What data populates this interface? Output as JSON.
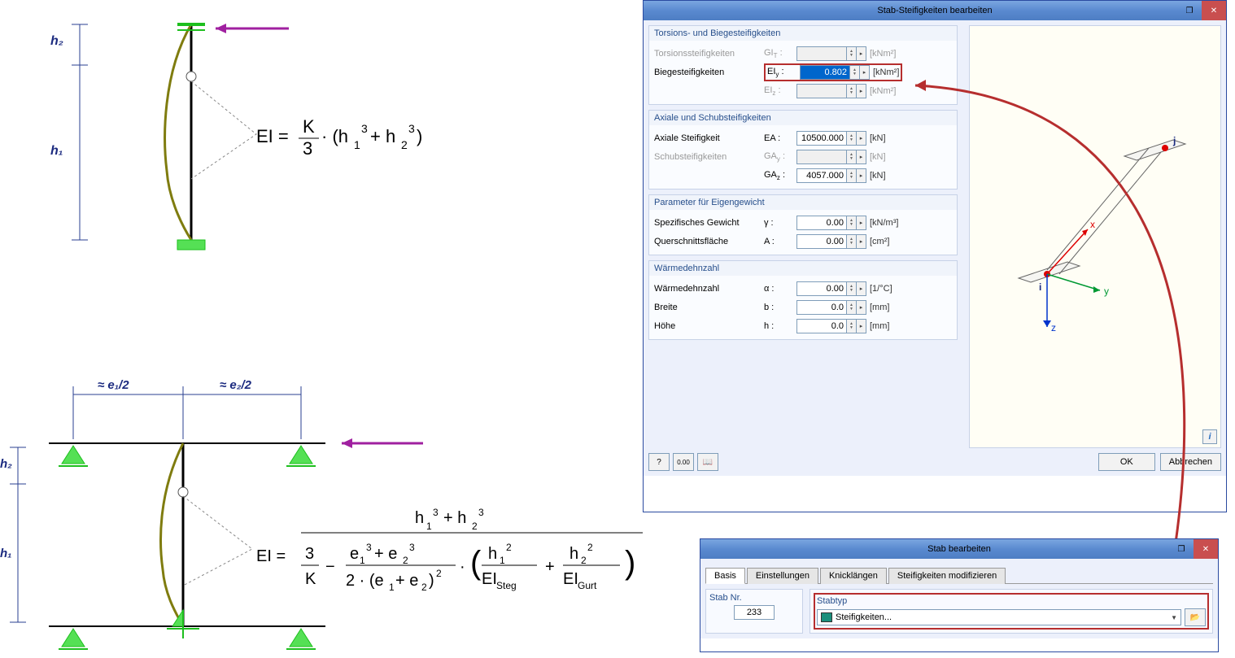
{
  "dialog1": {
    "title": "Stab-Steifigkeiten bearbeiten",
    "group1_title": "Torsions- und Biegesteifigkeiten",
    "row_torsion_label": "Torsionssteifigkeiten",
    "sym_GIT": "GIT :",
    "unit_kNm2": "[kNm²]",
    "row_biege_label": "Biegesteifigkeiten",
    "sym_EIy": "EIy :",
    "val_EIy": "0.802",
    "sym_EIz": "EIz :",
    "group2_title": "Axiale und Schubsteifigkeiten",
    "row_axial_label": "Axiale Steifigkeit",
    "sym_EA": "EA :",
    "val_EA": "10500.000",
    "unit_kN": "[kN]",
    "row_schub_label": "Schubsteifigkeiten",
    "sym_GAy": "GAy :",
    "sym_GAz": "GAz :",
    "val_GAz": "4057.000",
    "group3_title": "Parameter für Eigengewicht",
    "row_spez_label": "Spezifisches Gewicht",
    "sym_gamma": "γ :",
    "val_gamma": "0.00",
    "unit_kNm3": "[kN/m³]",
    "row_quer_label": "Querschnittsfläche",
    "sym_A": "A :",
    "val_A": "0.00",
    "unit_cm2": "[cm²]",
    "group4_title": "Wärmedehnzahl",
    "row_warme_label": "Wärmedehnzahl",
    "sym_alpha": "α :",
    "val_alpha": "0.00",
    "unit_1C": "[1/°C]",
    "row_breite_label": "Breite",
    "sym_b": "b :",
    "val_b": "0.0",
    "unit_mm": "[mm]",
    "row_hoehe_label": "Höhe",
    "sym_h": "h :",
    "val_h": "0.0",
    "ok": "OK",
    "cancel": "Abbrechen"
  },
  "dialog2": {
    "title": "Stab bearbeiten",
    "tabs": [
      "Basis",
      "Einstellungen",
      "Knicklängen",
      "Steifigkeiten modifizieren"
    ],
    "stabnr_label": "Stab Nr.",
    "stabnr_val": "233",
    "stabtyp_label": "Stabtyp",
    "stabtyp_val": "Steifigkeiten..."
  },
  "diagram": {
    "h1": "h₁",
    "h2": "h₂",
    "e1": "≈ e₁/2",
    "e2": "≈ e₂/2",
    "formula1_lhs": "EI =",
    "formula1_frac": "K",
    "formula1_den": "3",
    "formula1_rhs": "· (h₁³ + h₂³)",
    "formula2_lhs": "EI =",
    "formula2_num": "h₁³ + h₂³"
  },
  "axis": {
    "i": "i",
    "j": "j",
    "x": "x",
    "y": "y",
    "z": "z"
  }
}
